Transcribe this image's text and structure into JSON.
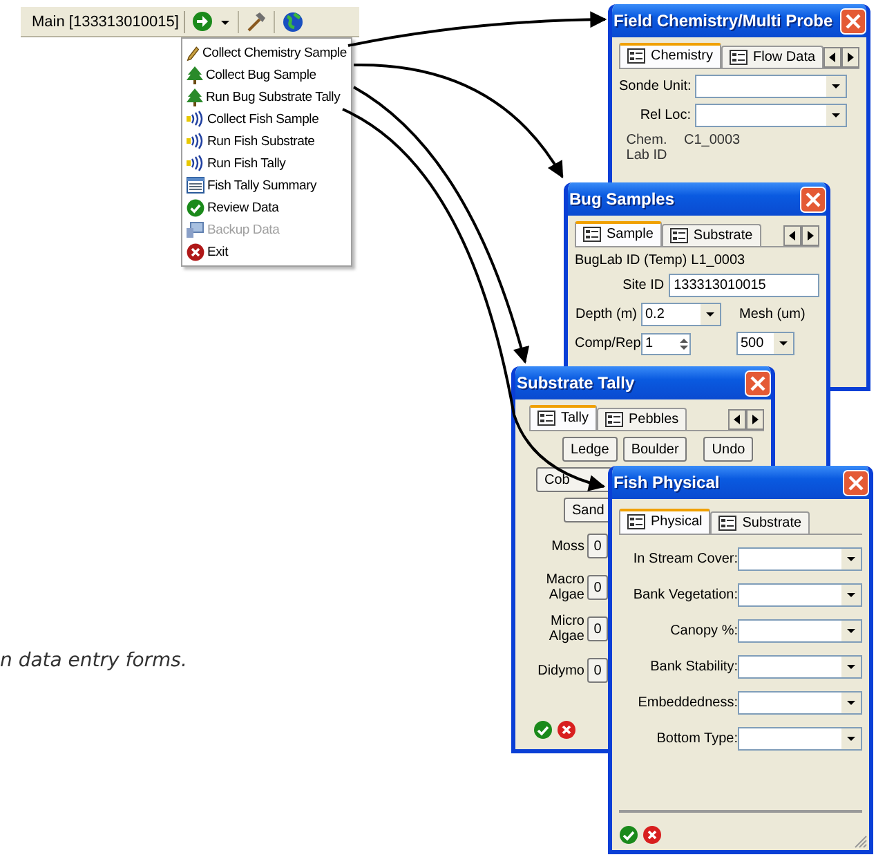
{
  "toolbar": {
    "main_button": "Main [133313010015]"
  },
  "menu": {
    "items": [
      {
        "kind": "pencil",
        "label": "Collect Chemistry Sample",
        "disabled": false
      },
      {
        "kind": "tree",
        "label": "Collect Bug Sample",
        "disabled": false
      },
      {
        "kind": "tree",
        "label": "Run Bug Substrate Tally",
        "disabled": false
      },
      {
        "kind": "wave",
        "label": "Collect Fish Sample",
        "disabled": false
      },
      {
        "kind": "wave",
        "label": "Run Fish Substrate",
        "disabled": false
      },
      {
        "kind": "wave",
        "label": "Run Fish Tally",
        "disabled": false
      },
      {
        "kind": "list",
        "label": "Fish Tally Summary",
        "disabled": false
      },
      {
        "kind": "check",
        "label": "Review Data",
        "disabled": false
      },
      {
        "kind": "computer",
        "label": "Backup Data",
        "disabled": true
      },
      {
        "kind": "exit",
        "label": "Exit",
        "disabled": false
      }
    ]
  },
  "field_chemistry": {
    "title": "Field Chemistry/Multi Probe",
    "tabs": [
      {
        "label": "Chemistry",
        "selected": true
      },
      {
        "label": "Flow Data",
        "selected": false
      }
    ],
    "fields": [
      {
        "label": "Sonde Unit:"
      },
      {
        "label": "Rel Loc:"
      }
    ],
    "lab_id": {
      "label": "Chem. Lab ID",
      "value": "C1_0003"
    }
  },
  "bug_samples": {
    "title": "Bug Samples",
    "tabs": [
      {
        "label": "Sample",
        "selected": true
      },
      {
        "label": "Substrate",
        "selected": false
      }
    ],
    "buglab_id": {
      "label": "BugLab ID (Temp)",
      "value": "L1_0003"
    },
    "site_id": {
      "label": "Site ID",
      "value": "133313010015"
    },
    "depth": {
      "label": "Depth (m)",
      "value": "0.2"
    },
    "mesh": {
      "label": "Mesh (um)",
      "value": "500"
    },
    "comp_rep": {
      "label": "Comp/Rep",
      "value": "1"
    }
  },
  "substrate_tally": {
    "title": "Substrate Tally",
    "tabs": [
      {
        "label": "Tally",
        "selected": true
      },
      {
        "label": "Pebbles",
        "selected": false
      }
    ],
    "top_buttons": [
      "Ledge",
      "Boulder",
      "Undo"
    ],
    "side_buttons": [
      "Cob",
      "Sand"
    ],
    "counters": [
      {
        "label": "Moss",
        "value": "0"
      },
      {
        "label": "Macro Algae",
        "value": "0"
      },
      {
        "label": "Micro Algae",
        "value": "0"
      },
      {
        "label": "Didymo",
        "value": "0"
      }
    ]
  },
  "fish_physical": {
    "title": "Fish Physical",
    "tabs": [
      {
        "label": "Physical",
        "selected": true
      },
      {
        "label": "Substrate",
        "selected": false
      }
    ],
    "fields": [
      {
        "label": "In Stream Cover:"
      },
      {
        "label": "Bank Vegetation:"
      },
      {
        "label": "Canopy %:"
      },
      {
        "label": "Bank Stability:"
      },
      {
        "label": "Embeddedness:"
      },
      {
        "label": "Bottom Type:"
      }
    ]
  },
  "caption": "n data entry forms."
}
